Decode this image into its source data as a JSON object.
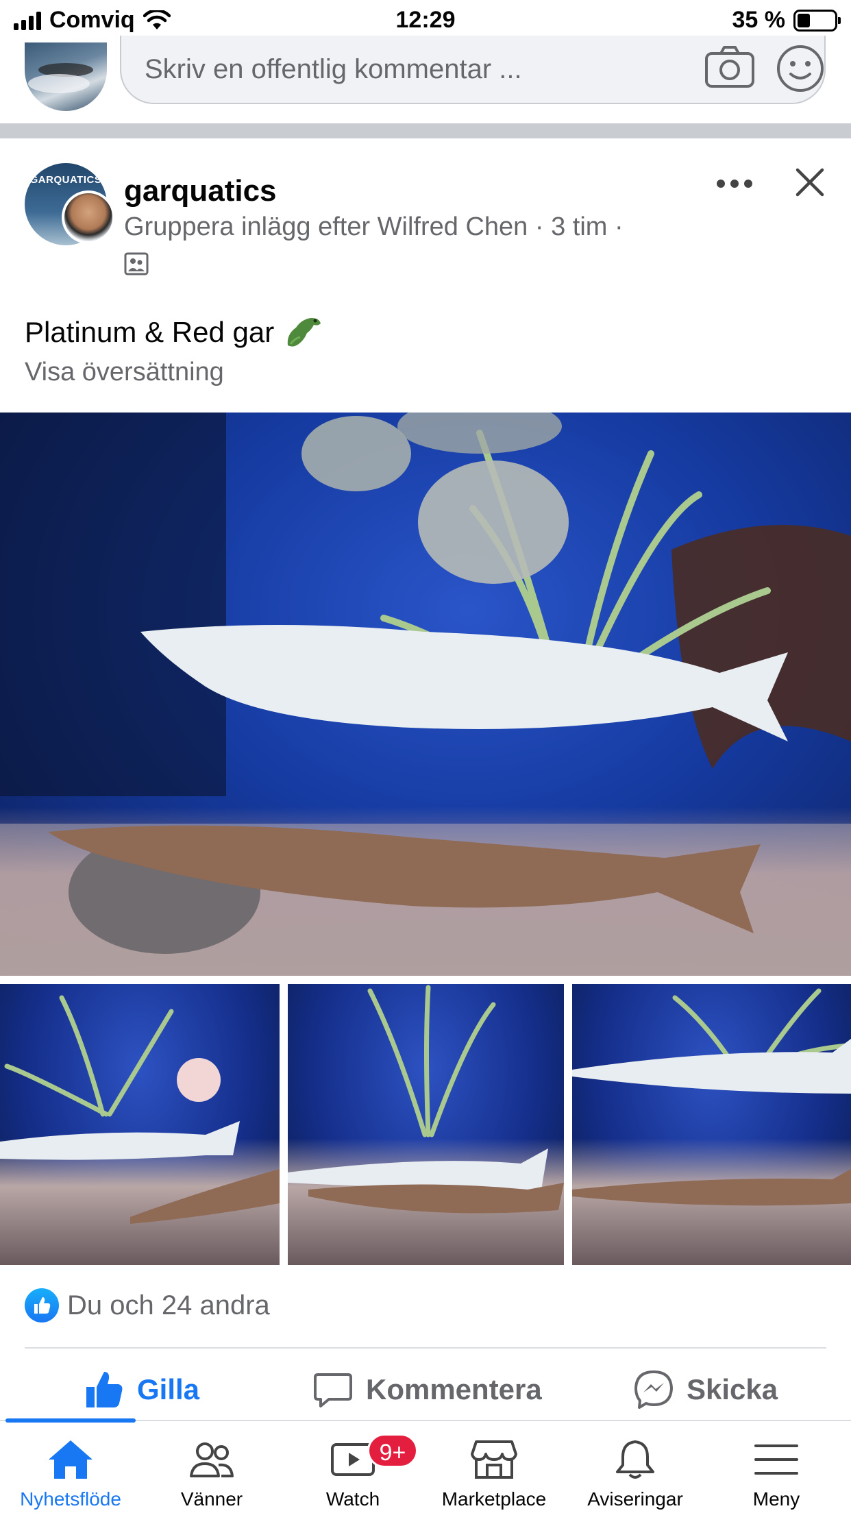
{
  "status_bar": {
    "carrier": "Comviq",
    "time": "12:29",
    "battery_percent": "35 %",
    "battery_level": 0.35
  },
  "comment_box": {
    "placeholder": "Skriv en offentlig kommentar ..."
  },
  "post": {
    "author": "garquatics",
    "avatar_text": "GARQUATICS",
    "meta": "Gruppera inlägg efter Wilfred Chen · 3 tim ·",
    "text": "Platinum & Red gar",
    "translate_label": "Visa översättning",
    "reactions_text": "Du och 24 andra",
    "photo_count_visible": 4
  },
  "actions": {
    "like": "Gilla",
    "comment": "Kommentera",
    "send": "Skicka"
  },
  "tabbar": {
    "tabs": [
      {
        "label": "Nyhetsflöde",
        "icon": "home-icon",
        "active": true
      },
      {
        "label": "Vänner",
        "icon": "friends-icon"
      },
      {
        "label": "Watch",
        "icon": "watch-icon",
        "badge": "9+"
      },
      {
        "label": "Marketplace",
        "icon": "marketplace-icon"
      },
      {
        "label": "Aviseringar",
        "icon": "bell-icon"
      },
      {
        "label": "Meny",
        "icon": "menu-icon"
      }
    ]
  },
  "colors": {
    "accent": "#1877f2",
    "badge": "#e41e3f",
    "secondary_text": "#65676b"
  }
}
